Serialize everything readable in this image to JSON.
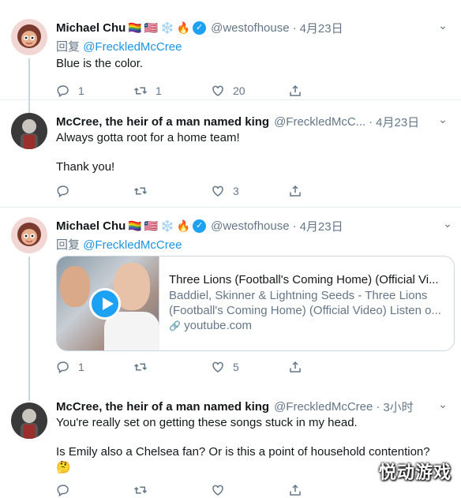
{
  "colors": {
    "accent": "#1da1f2",
    "mention": "#1b95e0",
    "muted": "#657786",
    "divider": "#e6ecf0"
  },
  "tweets": [
    {
      "name": "Michael Chu",
      "emojis": [
        "🏳️‍🌈",
        "🇱🇷",
        "❄️",
        "🔥"
      ],
      "verified": true,
      "handle": "@westofhouse",
      "dot": "·",
      "time": "4月23日",
      "reply_prefix": "回复",
      "reply_to": "@FreckledMcCree",
      "lines": [
        "Blue is the color."
      ],
      "reply_count": "1",
      "retweet_count": "1",
      "like_count": "20"
    },
    {
      "name": "McCree, the heir of a man named king",
      "handle": "@FreckledMcC...",
      "dot": "·",
      "time": "4月23日",
      "lines": [
        "Always gotta root for a home team!",
        "",
        "Thank you!"
      ],
      "reply_count": "",
      "retweet_count": "",
      "like_count": "3"
    },
    {
      "name": "Michael Chu",
      "emojis": [
        "🏳️‍🌈",
        "🇱🇷",
        "❄️",
        "🔥"
      ],
      "verified": true,
      "handle": "@westofhouse",
      "dot": "·",
      "time": "4月23日",
      "reply_prefix": "回复",
      "reply_to": "@FreckledMcCree",
      "card": {
        "title": "Three Lions (Football's Coming Home) (Official Vi...",
        "desc_line1": "Baddiel, Skinner & Lightning Seeds - Three Lions",
        "desc_line2": "(Football's Coming Home) (Official Video) Listen o...",
        "link_icon": "🔗",
        "link": "youtube.com"
      },
      "reply_count": "1",
      "retweet_count": "",
      "like_count": "5"
    },
    {
      "name": "McCree, the heir of a man named king",
      "handle": "@FreckledMcCree",
      "dot": "·",
      "time": "3小时",
      "lines": [
        "You're really set on getting these songs stuck in my head.",
        "",
        "Is Emily also a Chelsea fan? Or is this a point of household contention?"
      ],
      "thinking_emoji": "🤔",
      "reply_count": "",
      "retweet_count": "",
      "like_count": ""
    }
  ],
  "watermark": "悦动游戏"
}
